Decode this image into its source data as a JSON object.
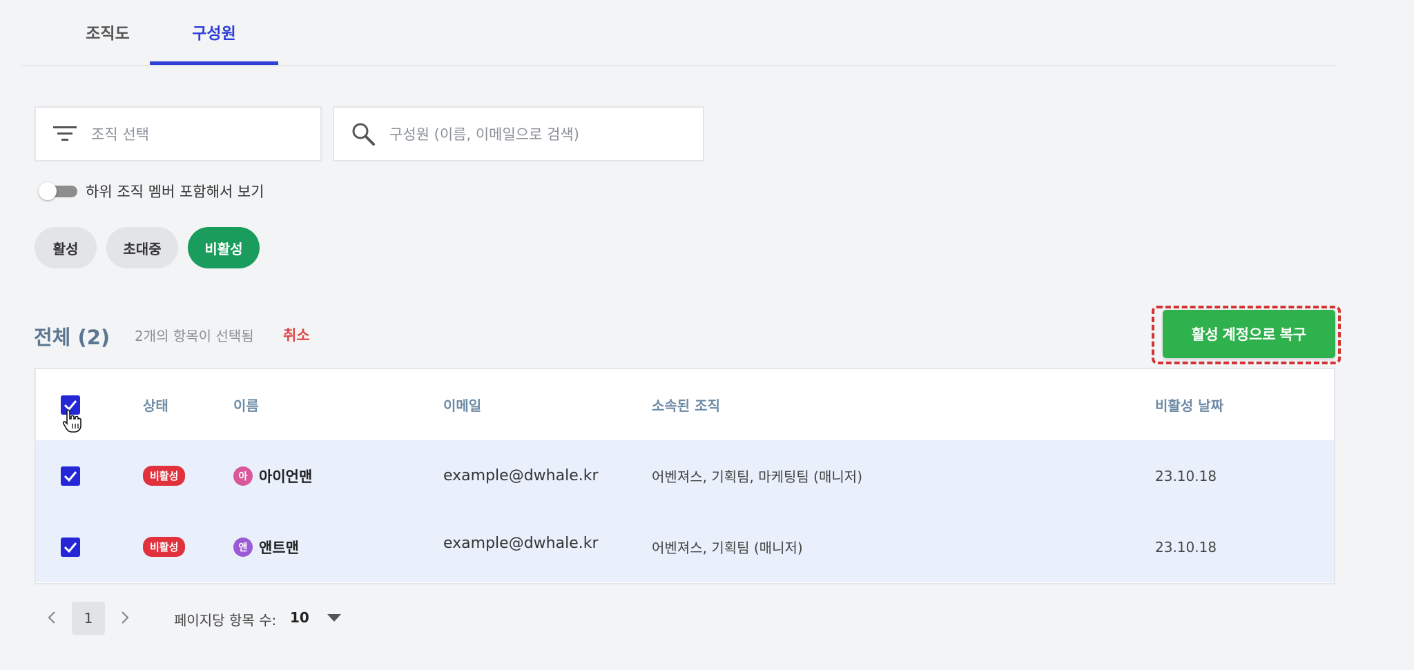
{
  "tabs": [
    {
      "label": "조직도",
      "active": false
    },
    {
      "label": "구성원",
      "active": true
    }
  ],
  "filters": {
    "org_placeholder": "조직 선택",
    "org_icon": "filter-icon",
    "search_placeholder": "구성원 (이름, 이메일으로 검색)",
    "search_icon": "search-icon"
  },
  "toggle": {
    "label": "하위 조직 멤버 포함해서 보기",
    "on": false
  },
  "status_chips": [
    {
      "label": "활성",
      "selected": false
    },
    {
      "label": "초대중",
      "selected": false
    },
    {
      "label": "비활성",
      "selected": true
    }
  ],
  "summary": {
    "total": "전체 (2)",
    "selected_text": "2개의 항목이 선택됨",
    "cancel": "취소"
  },
  "restore_button": "활성 계정으로 복구",
  "table": {
    "columns": [
      "상태",
      "이름",
      "이메일",
      "소속된 조직",
      "비활성 날짜"
    ],
    "rows": [
      {
        "checked": true,
        "status": "비활성",
        "avatar_text": "아",
        "avatar_color": "#d9589b",
        "name": "아이언맨",
        "email": "example@dwhale.kr",
        "org": "어벤져스, 기획팀, 마케팅팀 (매니저)",
        "date": "23.10.18"
      },
      {
        "checked": true,
        "status": "비활성",
        "avatar_text": "앤",
        "avatar_color": "#9b5bd6",
        "name": "앤트맨",
        "email": "example@dwhale.kr",
        "org": "어벤져스, 기획팀 (매니저)",
        "date": "23.10.18"
      }
    ]
  },
  "pagination": {
    "current_page": "1",
    "per_page_label": "페이지당 항목 수:",
    "per_page_value": "10"
  },
  "colors": {
    "accent_blue": "#2f3fd7",
    "inactive_chip_green": "#199c5c",
    "restore_green": "#2fb14d",
    "badge_red": "#e0313c"
  }
}
